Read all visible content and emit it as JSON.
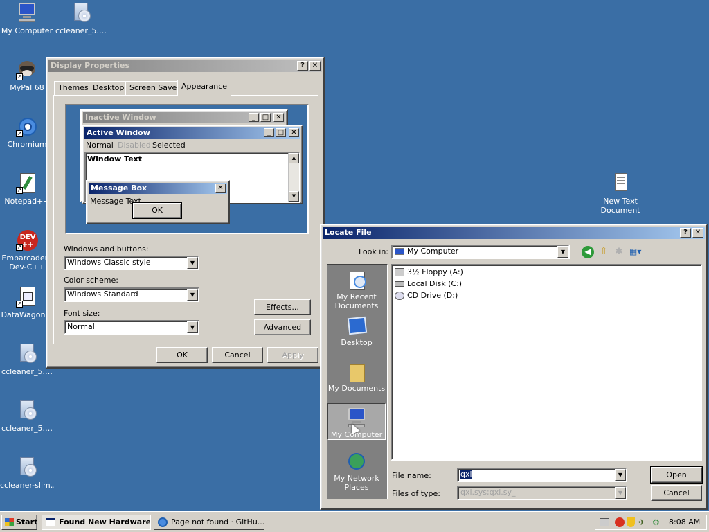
{
  "desktop": {
    "icons": [
      {
        "label": "My Computer",
        "icon": "computer-icon"
      },
      {
        "label": "ccleaner_5.…",
        "icon": "installer-icon"
      },
      {
        "label": "MyPal 68",
        "icon": "mypal-icon"
      },
      {
        "label": "Chromium",
        "icon": "chromium-icon"
      },
      {
        "label": "Notepad++",
        "icon": "notepadpp-icon"
      },
      {
        "label": "Embarcadero Dev-C++",
        "label_line1": "Embarcadero",
        "label_line2": "Dev-C++",
        "icon": "devcpp-icon"
      },
      {
        "label": "DataWagon…",
        "icon": "document-icon"
      },
      {
        "label": "ccleaner_5.…",
        "icon": "installer-icon"
      },
      {
        "label": "ccleaner_5.…",
        "icon": "installer-icon"
      },
      {
        "label": "ccleaner-slim…",
        "icon": "installer-icon"
      },
      {
        "label_line1": "New Text",
        "label_line2": "Document",
        "icon": "text-document-icon"
      }
    ]
  },
  "display_properties": {
    "title": "Display Properties",
    "help_btn": "?",
    "close_btn": "✕",
    "tabs": [
      "Themes",
      "Desktop",
      "Screen Saver",
      "Appearance"
    ],
    "selected_tab": "Appearance",
    "preview": {
      "inactive_title": "Inactive Window",
      "active_title": "Active Window",
      "menu_normal": "Normal",
      "menu_disabled": "Disabled",
      "menu_selected": "Selected",
      "window_text": "Window Text",
      "msgbox_title": "Message Box",
      "msgbox_text": "Message Text",
      "msgbox_ok": "OK"
    },
    "windows_buttons_label": "Windows and buttons:",
    "windows_buttons_value": "Windows Classic style",
    "color_scheme_label": "Color scheme:",
    "color_scheme_value": "Windows Standard",
    "font_size_label": "Font size:",
    "font_size_value": "Normal",
    "effects_btn": "Effects...",
    "advanced_btn": "Advanced",
    "ok_btn": "OK",
    "cancel_btn": "Cancel",
    "apply_btn": "Apply"
  },
  "locate_file": {
    "title": "Locate File",
    "help_btn": "?",
    "close_btn": "✕",
    "look_in_label": "Look in:",
    "look_in_value": "My Computer",
    "places": [
      "My Recent Documents",
      "Desktop",
      "My Documents",
      "My Computer",
      "My Network Places"
    ],
    "places_lines": [
      [
        "My Recent",
        "Documents"
      ],
      [
        "Desktop"
      ],
      [
        "My Documents"
      ],
      [
        "My Computer"
      ],
      [
        "My Network",
        "Places"
      ]
    ],
    "selected_place": "My Computer",
    "files": [
      "3½ Floppy (A:)",
      "Local Disk (C:)",
      "CD Drive (D:)"
    ],
    "file_name_label": "File name:",
    "file_name_value": "qxl",
    "files_of_type_label": "Files of type:",
    "files_of_type_value": "qxl.sys;qxl.sy_",
    "open_btn": "Open",
    "cancel_btn": "Cancel"
  },
  "taskbar": {
    "start_label": "Start",
    "tasks": [
      "Found New Hardware...",
      "Page not found · GitHu..."
    ],
    "clock": "8:08 AM"
  },
  "colors": {
    "desktop": "#3a6ea5",
    "active_title_start": "#0a246a",
    "active_title_end": "#a6caf0",
    "face": "#d4d0c8"
  }
}
